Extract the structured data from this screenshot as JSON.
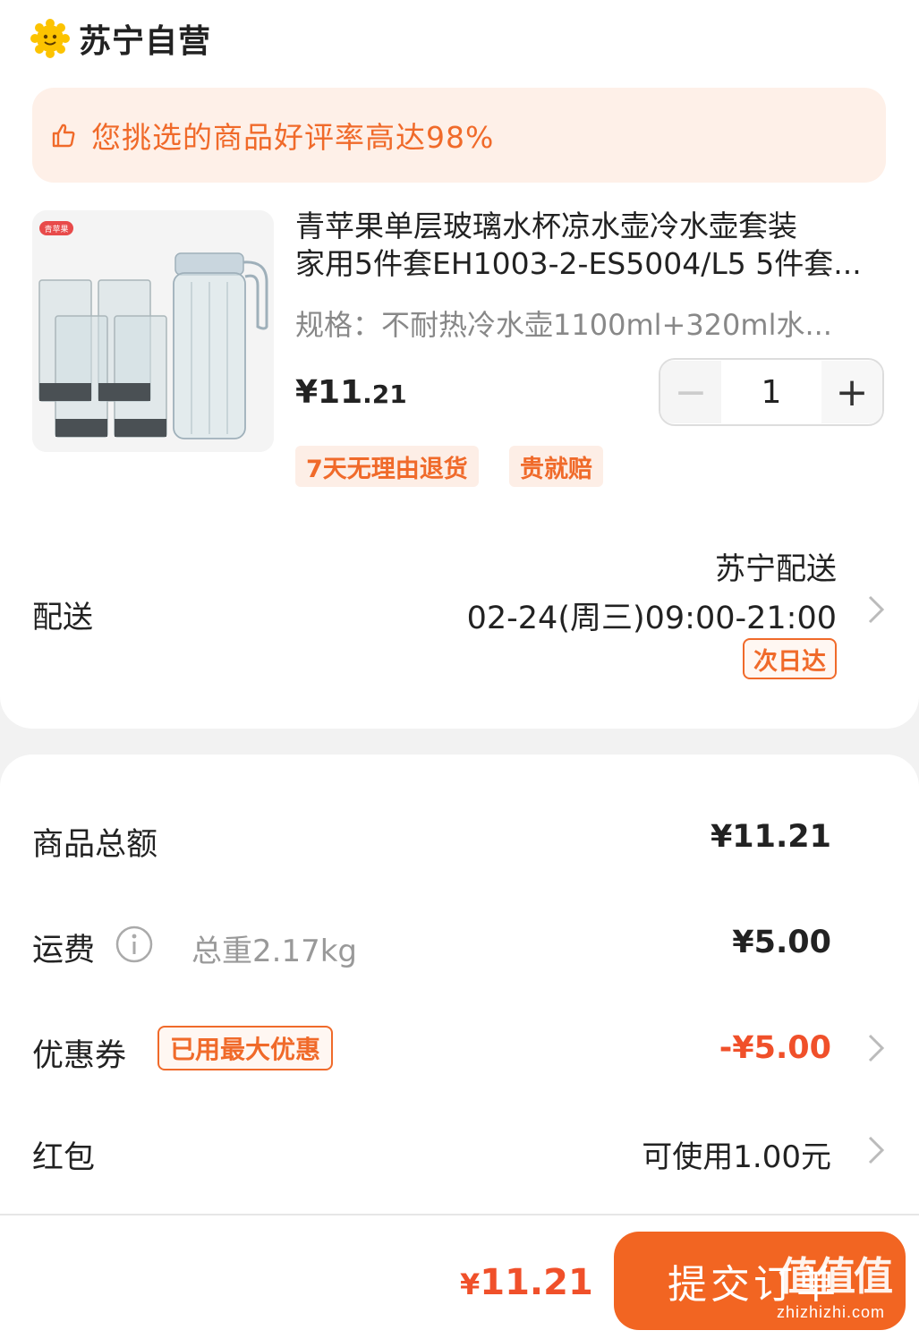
{
  "store": {
    "name": "苏宁自营",
    "logo_icon": "sun-face-icon"
  },
  "rating_banner": {
    "text": "您挑选的商品好评率高达98%",
    "icon": "thumbs-up-icon"
  },
  "product": {
    "title_line1": "青苹果单层玻璃水杯凉水壶冷水壶套装",
    "title_line2": "家用5件套EH1003-2-ES5004/L5 5件套...",
    "spec": "规格：不耐热冷水壶1100ml+320ml水...",
    "price_big": "¥11",
    "price_small": ".21",
    "quantity": "1",
    "qty_minus": "−",
    "qty_plus": "+",
    "tags": [
      "7天无理由退货",
      "贵就赔"
    ],
    "image_brand": "青苹果"
  },
  "delivery": {
    "label": "配送",
    "method": "苏宁配送",
    "time": "02-24(周三)09:00-21:00",
    "badge": "次日达"
  },
  "summary": {
    "goods_total_label": "商品总额",
    "goods_total_value": "¥11.21",
    "shipping_label": "运费",
    "shipping_weight": "总重2.17kg",
    "shipping_value": "¥5.00",
    "coupon_label": "优惠券",
    "coupon_badge": "已用最大优惠",
    "coupon_value": "-¥5.00",
    "redpack_label": "红包",
    "redpack_value": "可使用1.00元"
  },
  "bottom": {
    "total_yen": "¥",
    "total_num": "11.21",
    "submit_label": "提交订单"
  },
  "watermark": {
    "text": "zhizhizhi.com",
    "glyphs": "值值值"
  },
  "colors": {
    "accent": "#f06a2a",
    "button": "#f26522",
    "discount": "#f0502a"
  }
}
